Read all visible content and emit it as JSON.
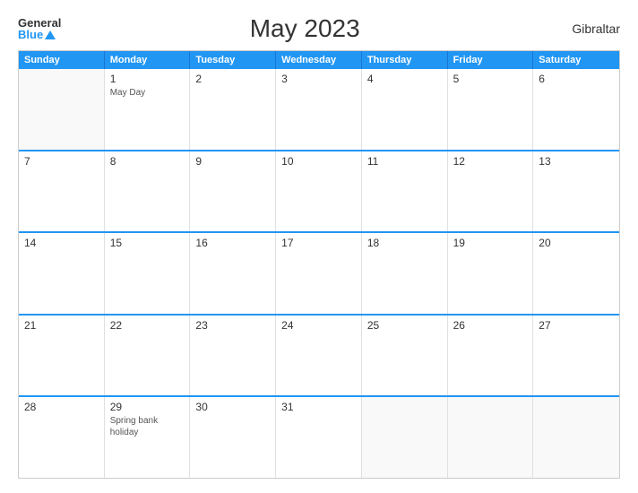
{
  "header": {
    "logo_general": "General",
    "logo_blue": "Blue",
    "title": "May 2023",
    "region": "Gibraltar"
  },
  "day_headers": [
    "Sunday",
    "Monday",
    "Tuesday",
    "Wednesday",
    "Thursday",
    "Friday",
    "Saturday"
  ],
  "weeks": [
    [
      {
        "num": "",
        "events": []
      },
      {
        "num": "1",
        "events": [
          "May Day"
        ]
      },
      {
        "num": "2",
        "events": []
      },
      {
        "num": "3",
        "events": []
      },
      {
        "num": "4",
        "events": []
      },
      {
        "num": "5",
        "events": []
      },
      {
        "num": "6",
        "events": []
      }
    ],
    [
      {
        "num": "7",
        "events": []
      },
      {
        "num": "8",
        "events": []
      },
      {
        "num": "9",
        "events": []
      },
      {
        "num": "10",
        "events": []
      },
      {
        "num": "11",
        "events": []
      },
      {
        "num": "12",
        "events": []
      },
      {
        "num": "13",
        "events": []
      }
    ],
    [
      {
        "num": "14",
        "events": []
      },
      {
        "num": "15",
        "events": []
      },
      {
        "num": "16",
        "events": []
      },
      {
        "num": "17",
        "events": []
      },
      {
        "num": "18",
        "events": []
      },
      {
        "num": "19",
        "events": []
      },
      {
        "num": "20",
        "events": []
      }
    ],
    [
      {
        "num": "21",
        "events": []
      },
      {
        "num": "22",
        "events": []
      },
      {
        "num": "23",
        "events": []
      },
      {
        "num": "24",
        "events": []
      },
      {
        "num": "25",
        "events": []
      },
      {
        "num": "26",
        "events": []
      },
      {
        "num": "27",
        "events": []
      }
    ],
    [
      {
        "num": "28",
        "events": []
      },
      {
        "num": "29",
        "events": [
          "Spring bank",
          "holiday"
        ]
      },
      {
        "num": "30",
        "events": []
      },
      {
        "num": "31",
        "events": []
      },
      {
        "num": "",
        "events": []
      },
      {
        "num": "",
        "events": []
      },
      {
        "num": "",
        "events": []
      }
    ]
  ]
}
